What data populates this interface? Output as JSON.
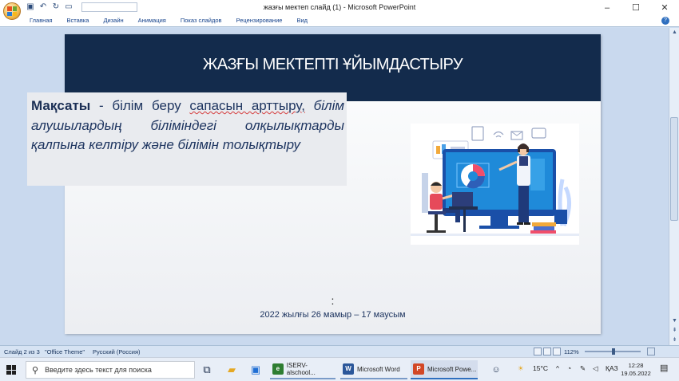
{
  "window": {
    "title": "жазғы мектеп слайд (1) - Microsoft PowerPoint",
    "controls": [
      "–",
      "☐",
      "✕"
    ]
  },
  "ribbon": {
    "tabs": [
      "Главная",
      "Вставка",
      "Дизайн",
      "Анимация",
      "Показ слайдов",
      "Рецензирование",
      "Вид"
    ]
  },
  "slide": {
    "header_title": "ЖАЗҒЫ МЕКТЕПТІ ҰЙЫМДАСТЫРУ",
    "goal_label": "Мақсаты",
    "goal_sep": " - білім  беру ",
    "goal_underlined": "сапасын арттыру,",
    "goal_italic": "білім алушылардың біліміндегі олқылықтарды қалпына келтіру және білімін толықтыру",
    "colon": ":",
    "dates": "2022 жылғы 26 мамыр – 17 маусым"
  },
  "statusbar": {
    "slide_count": "Слайд 2 из 3",
    "theme": "\"Office Theme\"",
    "language": "Русский (Россия)",
    "zoom": "112%"
  },
  "taskbar": {
    "search_placeholder": "Введите здесь текст для поиска",
    "apps": [
      {
        "label": "ISERV-alschool...",
        "color": "#2e7d32"
      },
      {
        "label": "Microsoft Word",
        "color": "#2b579a"
      },
      {
        "label": "Microsoft Powe...",
        "color": "#d24726"
      }
    ],
    "temperature": "15°C",
    "keyboard": "ҚАЗ",
    "time": "12:28",
    "date": "19.05.2022"
  }
}
